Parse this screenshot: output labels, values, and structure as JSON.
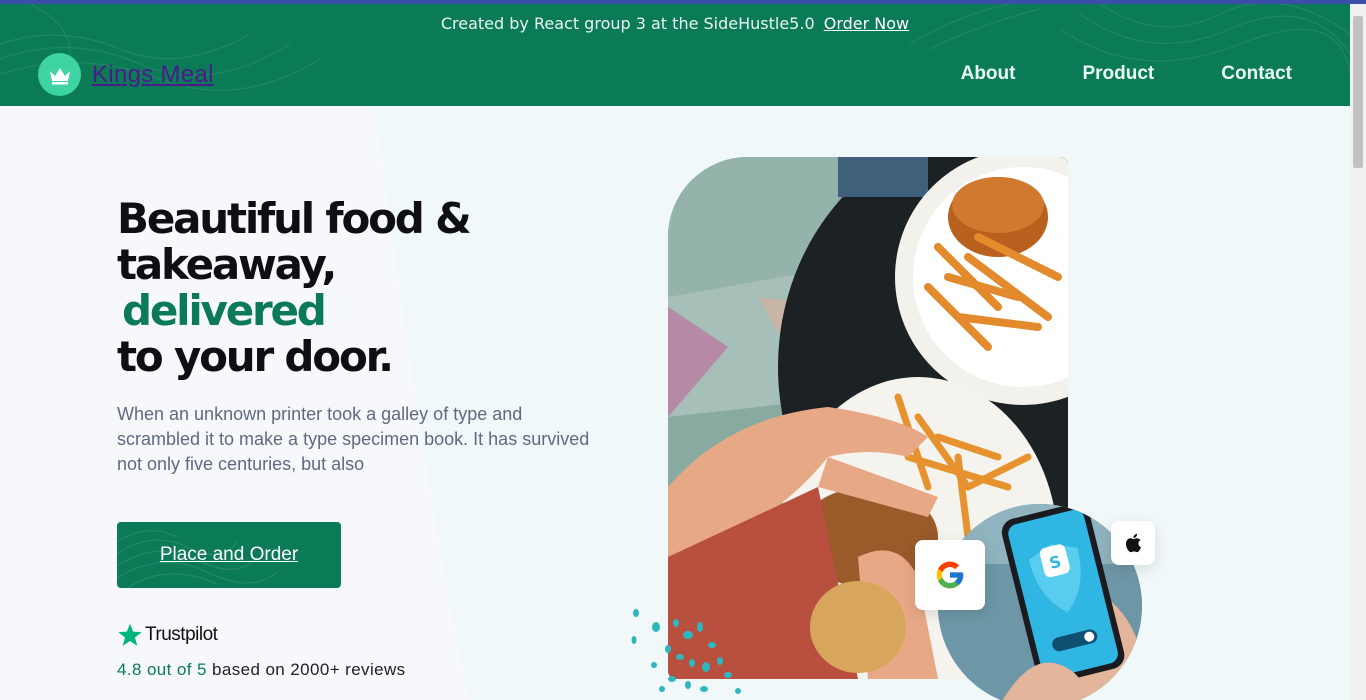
{
  "announcement": {
    "text": "Created by React group 3 at the SideHustle5.0",
    "link_label": "Order Now"
  },
  "brand": {
    "name": "Kings Meal",
    "icon": "crown-icon"
  },
  "nav": {
    "items": [
      {
        "label": "About"
      },
      {
        "label": "Product"
      },
      {
        "label": "Contact"
      }
    ]
  },
  "hero": {
    "title_line1": "Beautiful food &",
    "title_line2": "takeaway,",
    "title_highlight": "delivered",
    "title_line4": "to your door.",
    "description": "When an unknown printer took a galley of type and scrambled it to make a type specimen book. It has survived not only five centuries, but also",
    "cta_label": "Place and Order"
  },
  "trustpilot": {
    "name": "Trustpilot",
    "icon": "star-icon",
    "rating_highlight": "4.8 out of 5",
    "rating_rest": "based on 2000+ reviews"
  },
  "badges": {
    "google_icon": "google-icon",
    "apple_icon": "apple-icon"
  },
  "colors": {
    "brand_green": "#0b7a57",
    "mint": "#3ed3a2",
    "logo_text": "#4b1b8c"
  }
}
